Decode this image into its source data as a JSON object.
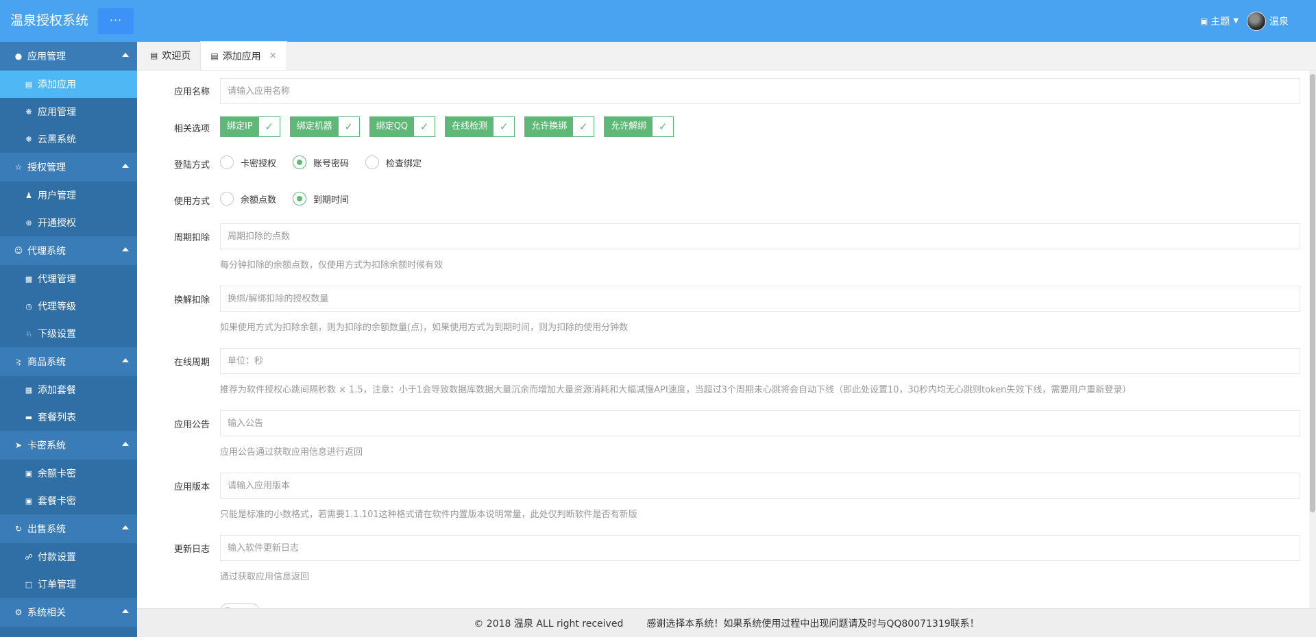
{
  "header": {
    "brand": "温泉授权系统",
    "menu_button": "···",
    "theme": {
      "icon": "chat-icon",
      "label": "主题"
    },
    "user": {
      "name": "温泉"
    }
  },
  "sidebar": {
    "groups": [
      {
        "icon": "circle-icon",
        "label": "应用管理",
        "items": [
          {
            "icon": "window-icon",
            "label": "添加应用",
            "active": true
          },
          {
            "icon": "fan-icon",
            "label": "应用管理"
          },
          {
            "icon": "fan-icon",
            "label": "云黑系统"
          }
        ]
      },
      {
        "icon": "star-icon",
        "label": "授权管理",
        "items": [
          {
            "icon": "user-icon",
            "label": "用户管理"
          },
          {
            "icon": "plus-circle-icon",
            "label": "开通授权"
          }
        ]
      },
      {
        "icon": "user-outline-icon",
        "label": "代理系统",
        "items": [
          {
            "icon": "image-icon",
            "label": "代理管理"
          },
          {
            "icon": "clock-icon",
            "label": "代理等级"
          },
          {
            "icon": "sub-icon",
            "label": "下级设置"
          }
        ]
      },
      {
        "icon": "share-icon",
        "label": "商品系统",
        "items": [
          {
            "icon": "grid-icon",
            "label": "添加套餐"
          },
          {
            "icon": "card-icon",
            "label": "套餐列表"
          }
        ]
      },
      {
        "icon": "send-icon",
        "label": "卡密系统",
        "items": [
          {
            "icon": "app-add-icon",
            "label": "余额卡密"
          },
          {
            "icon": "app-add-icon",
            "label": "套餐卡密"
          }
        ]
      },
      {
        "icon": "refresh-icon",
        "label": "出售系统",
        "items": [
          {
            "icon": "cart-icon",
            "label": "付款设置"
          },
          {
            "icon": "file-icon",
            "label": "订单管理"
          }
        ]
      },
      {
        "icon": "gear-icon",
        "label": "系统相关",
        "items": []
      }
    ]
  },
  "tabs": [
    {
      "label": "欢迎页",
      "active": false
    },
    {
      "label": "添加应用",
      "active": true,
      "close": "×"
    }
  ],
  "form": {
    "app_name": {
      "label": "应用名称",
      "placeholder": "请输入应用名称"
    },
    "options": {
      "label": "相关选项",
      "checks": [
        "绑定IP",
        "绑定机器",
        "绑定QQ",
        "在线检测",
        "允许换绑",
        "允许解绑"
      ],
      "checkmark": "✓"
    },
    "login_mode": {
      "label": "登陆方式",
      "options": [
        "卡密授权",
        "账号密码",
        "检查绑定"
      ],
      "selected": "账号密码"
    },
    "usage_mode": {
      "label": "使用方式",
      "options": [
        "余额点数",
        "到期时间"
      ],
      "selected": "到期时间"
    },
    "period_deduct": {
      "label": "周期扣除",
      "placeholder": "周期扣除的点数",
      "help": "每分钟扣除的余额点数，仅使用方式为扣除余额时候有效"
    },
    "rebind_deduct": {
      "label": "换解扣除",
      "placeholder": "换绑/解绑扣除的授权数量",
      "help": "如果使用方式为扣除余额，则为扣除的余额数量(点)，如果使用方式为到期时间，则为扣除的使用分钟数"
    },
    "online_period": {
      "label": "在线周期",
      "placeholder": "单位：秒",
      "help": "推荐为软件授权心跳间隔秒数 × 1.5，注意：小于1会导致数据库数据大量沉余而增加大量资源消耗和大幅减慢API速度，当超过3个周期未心跳将会自动下线（即此处设置10，30秒内均无心跳则token失效下线，需要用户重新登录）"
    },
    "notice": {
      "label": "应用公告",
      "placeholder": "输入公告",
      "help": "应用公告通过获取应用信息进行返回"
    },
    "version": {
      "label": "应用版本",
      "placeholder": "请输入应用版本",
      "help": "只能是标准的小数格式，若需要1.1.101这种格式请在软件内置版本说明常量，此处仅判断软件是否有新版"
    },
    "changelog": {
      "label": "更新日志",
      "placeholder": "输入软件更新日志",
      "help": "通过获取应用信息返回"
    }
  },
  "footer": {
    "copyright": "© 2018 温泉 ALL right received",
    "thanks": "感谢选择本系统！如果系统使用过程中出现问题请及时与QQ80071319联系！"
  },
  "colors": {
    "header": "#4aa3f0",
    "sidebar": "#2f6fa5",
    "sidebar_group": "#3a7cb8",
    "sidebar_active": "#4db8f5",
    "accent_green": "#5fb878"
  }
}
